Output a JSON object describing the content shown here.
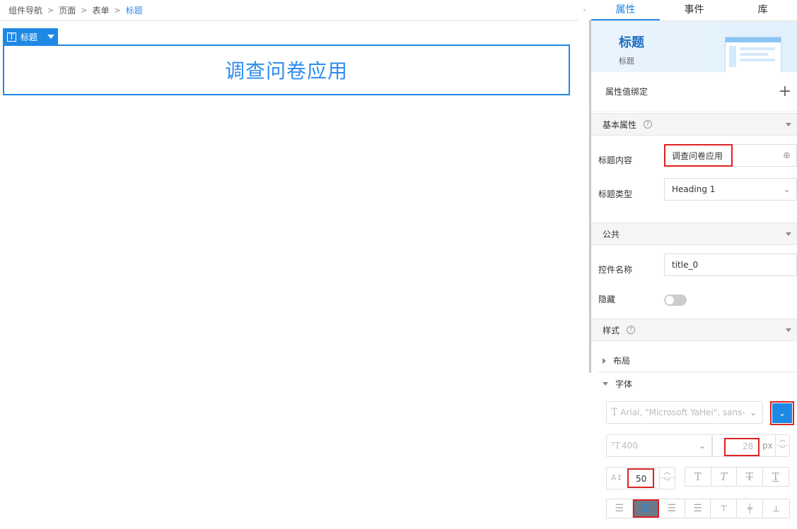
{
  "breadcrumb": {
    "items": [
      "组件导航",
      "页面",
      "表单"
    ],
    "current": "标题",
    "separator": ">"
  },
  "canvas": {
    "tag_label": "标题",
    "tag_icon": "T",
    "heading_text": "调查问卷应用"
  },
  "panel": {
    "tabs": [
      {
        "label": "属性",
        "active": true
      },
      {
        "label": "事件",
        "active": false
      },
      {
        "label": "库",
        "active": false
      }
    ],
    "hero": {
      "title": "标题",
      "subtitle": "标题"
    },
    "binding": {
      "label": "属性值绑定",
      "add_icon": "+"
    },
    "basic": {
      "section_title": "基本属性",
      "content_label": "标题内容",
      "content_value": "调查问卷应用",
      "type_label": "标题类型",
      "type_value": "Heading 1"
    },
    "public": {
      "section_title": "公共",
      "name_label": "控件名称",
      "name_value": "title_0",
      "hidden_label": "隐藏",
      "hidden_on": false
    },
    "style": {
      "section_title": "样式",
      "layout_label": "布局",
      "font_label": "字体",
      "font_family_placeholder": "Arial, \"Microsoft YaHei\", sans-...",
      "font_weight": "400",
      "font_size": "28",
      "font_size_unit": "px",
      "line_height": "50",
      "text_style_buttons": [
        "T",
        "T",
        "T",
        "T"
      ],
      "align_buttons": [
        "align-left",
        "align-center",
        "align-right",
        "align-justify",
        "valign-top",
        "valign-middle",
        "valign-bottom"
      ],
      "selected_align": "align-center"
    }
  },
  "colors": {
    "accent": "#1e88e5",
    "link": "#2d8cf0",
    "highlight_red": "#dd2222"
  }
}
